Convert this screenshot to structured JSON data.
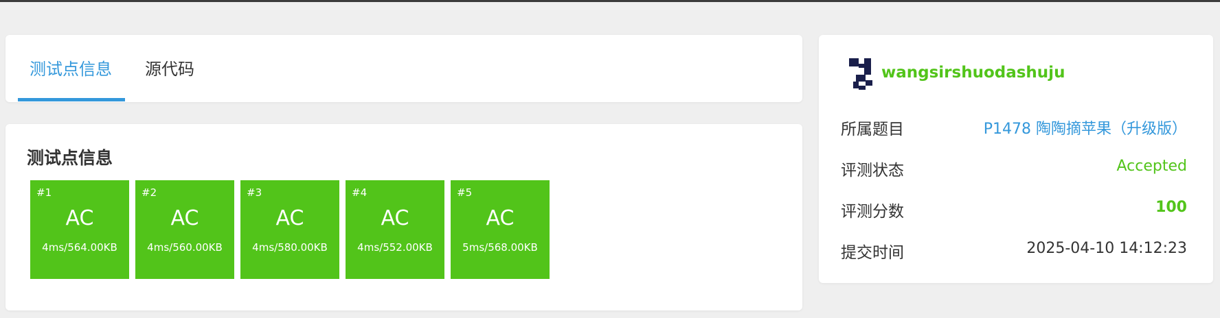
{
  "tabs": [
    {
      "label": "测试点信息",
      "active": true
    },
    {
      "label": "源代码",
      "active": false
    }
  ],
  "testcases": {
    "title": "测试点信息",
    "items": [
      {
        "num": "#1",
        "status": "AC",
        "info": "4ms/564.00KB"
      },
      {
        "num": "#2",
        "status": "AC",
        "info": "4ms/560.00KB"
      },
      {
        "num": "#3",
        "status": "AC",
        "info": "4ms/580.00KB"
      },
      {
        "num": "#4",
        "status": "AC",
        "info": "4ms/552.00KB"
      },
      {
        "num": "#5",
        "status": "AC",
        "info": "5ms/568.00KB"
      }
    ]
  },
  "submission": {
    "username": "wangsirshuodashuju",
    "rows": [
      {
        "label": "所属题目",
        "value": "P1478 陶陶摘苹果（升级版）"
      },
      {
        "label": "评测状态",
        "value": "Accepted"
      },
      {
        "label": "评测分数",
        "value": "100"
      },
      {
        "label": "提交时间",
        "value": "2025-04-10 14:12:23"
      }
    ]
  },
  "colors": {
    "accent": "#3498db",
    "accepted": "#52c41a",
    "avatar": "#1a1f4b"
  }
}
